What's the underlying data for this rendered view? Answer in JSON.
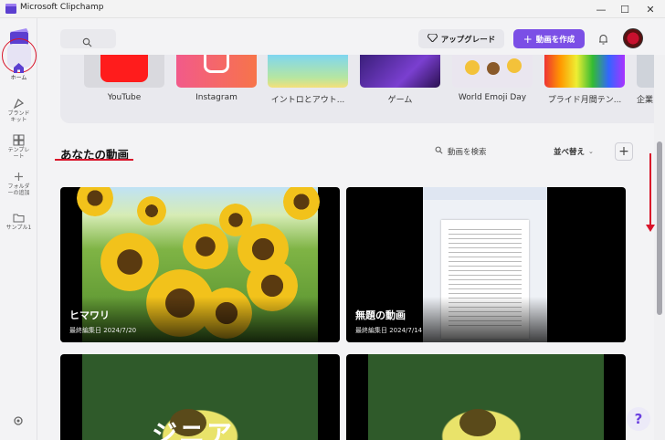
{
  "window": {
    "title": "Microsoft Clipchamp",
    "minimize": "—",
    "maximize": "☐",
    "close": "✕"
  },
  "sidebar": {
    "items": [
      {
        "label": "ホーム",
        "icon": "home-icon"
      },
      {
        "label": "ブランド\nキット",
        "icon": "brand-kit-icon"
      },
      {
        "label": "テンプレ\nート",
        "icon": "template-icon"
      },
      {
        "label": "フォルダ\nーの追加",
        "icon": "add-folder-icon"
      },
      {
        "label": "サンプル1",
        "icon": "folder-icon"
      }
    ]
  },
  "header": {
    "upgrade_label": "アップグレード",
    "create_label": "動画を作成"
  },
  "templates": [
    {
      "label": "YouTube"
    },
    {
      "label": "Instagram"
    },
    {
      "label": "イントロとアウト..."
    },
    {
      "label": "ゲーム"
    },
    {
      "label": "World Emoji Day"
    },
    {
      "label": "プライド月間テン..."
    },
    {
      "label": "企業"
    }
  ],
  "videos_section": {
    "title": "あなたの動画",
    "search_label": "動画を検索",
    "sort_label": "並べ替え"
  },
  "videos": [
    {
      "title": "ヒマワリ",
      "date": "最終編集日 2024/7/20"
    },
    {
      "title": "無題の動画",
      "date": "最終編集日 2024/7/14"
    },
    {
      "title": "ジニア",
      "date": ""
    },
    {
      "title": "",
      "date": ""
    }
  ],
  "colors": {
    "accent": "#7b4fe6",
    "annotation_red": "#d9142a"
  }
}
